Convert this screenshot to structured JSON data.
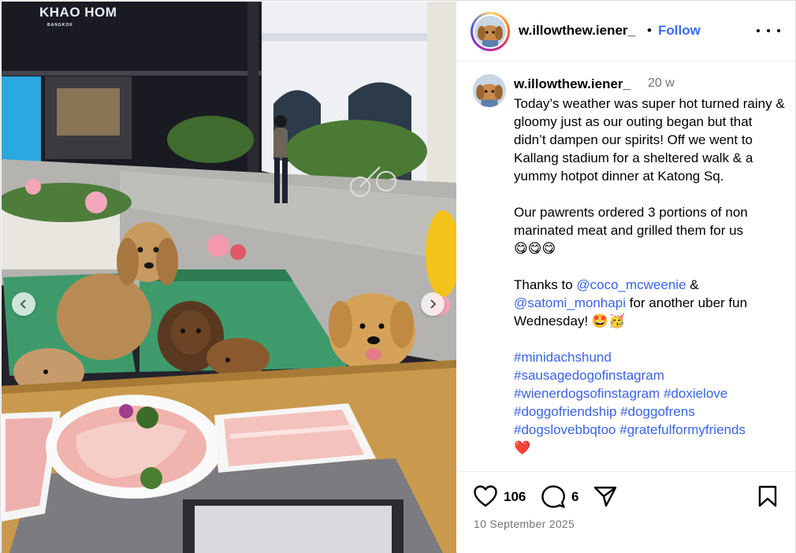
{
  "post": {
    "shop_sign": "KHAO HOM",
    "shop_sign_sub": "BANGKOK"
  },
  "header": {
    "username": "w.illowthew.iener_",
    "separator": "•",
    "follow_label": "Follow",
    "more_icon": "more-horizontal-icon"
  },
  "caption": {
    "username": "w.illowthew.iener_",
    "time": "20 w",
    "para1": "Today’s weather was super hot turned rainy & gloomy just as our outing began but that didn’t dampen our spirits! Off we went to Kallang stadium for a sheltered walk & a yummy hotpot dinner at Katong Sq.",
    "para2": "Our pawrents ordered 3 portions of non marinated meat and grilled them for us",
    "para2_emoji": "😋😋😋",
    "thanks_prefix": "Thanks to ",
    "mention1": "@coco_mcweenie",
    "thanks_amp": " &",
    "mention2": "@satomi_monhapi",
    "thanks_suffix": " for another uber fun Wednesday! ",
    "thanks_emoji": "🤩🥳",
    "hashtags": [
      "#minidachshund",
      "#sausagedogofinstagram",
      "#wienerdogsofinstagram",
      "#doxielove",
      "#doggofriendship",
      "#doggofrens",
      "#dogslovebbqtoo",
      "#gratefulformyfriends"
    ],
    "end_emoji": "❤️"
  },
  "actions": {
    "likes": "106",
    "comments": "6",
    "date": "10 September 2025"
  },
  "colors": {
    "link": "#3a63e8",
    "muted": "#737373",
    "border": "#dbdbdb"
  }
}
